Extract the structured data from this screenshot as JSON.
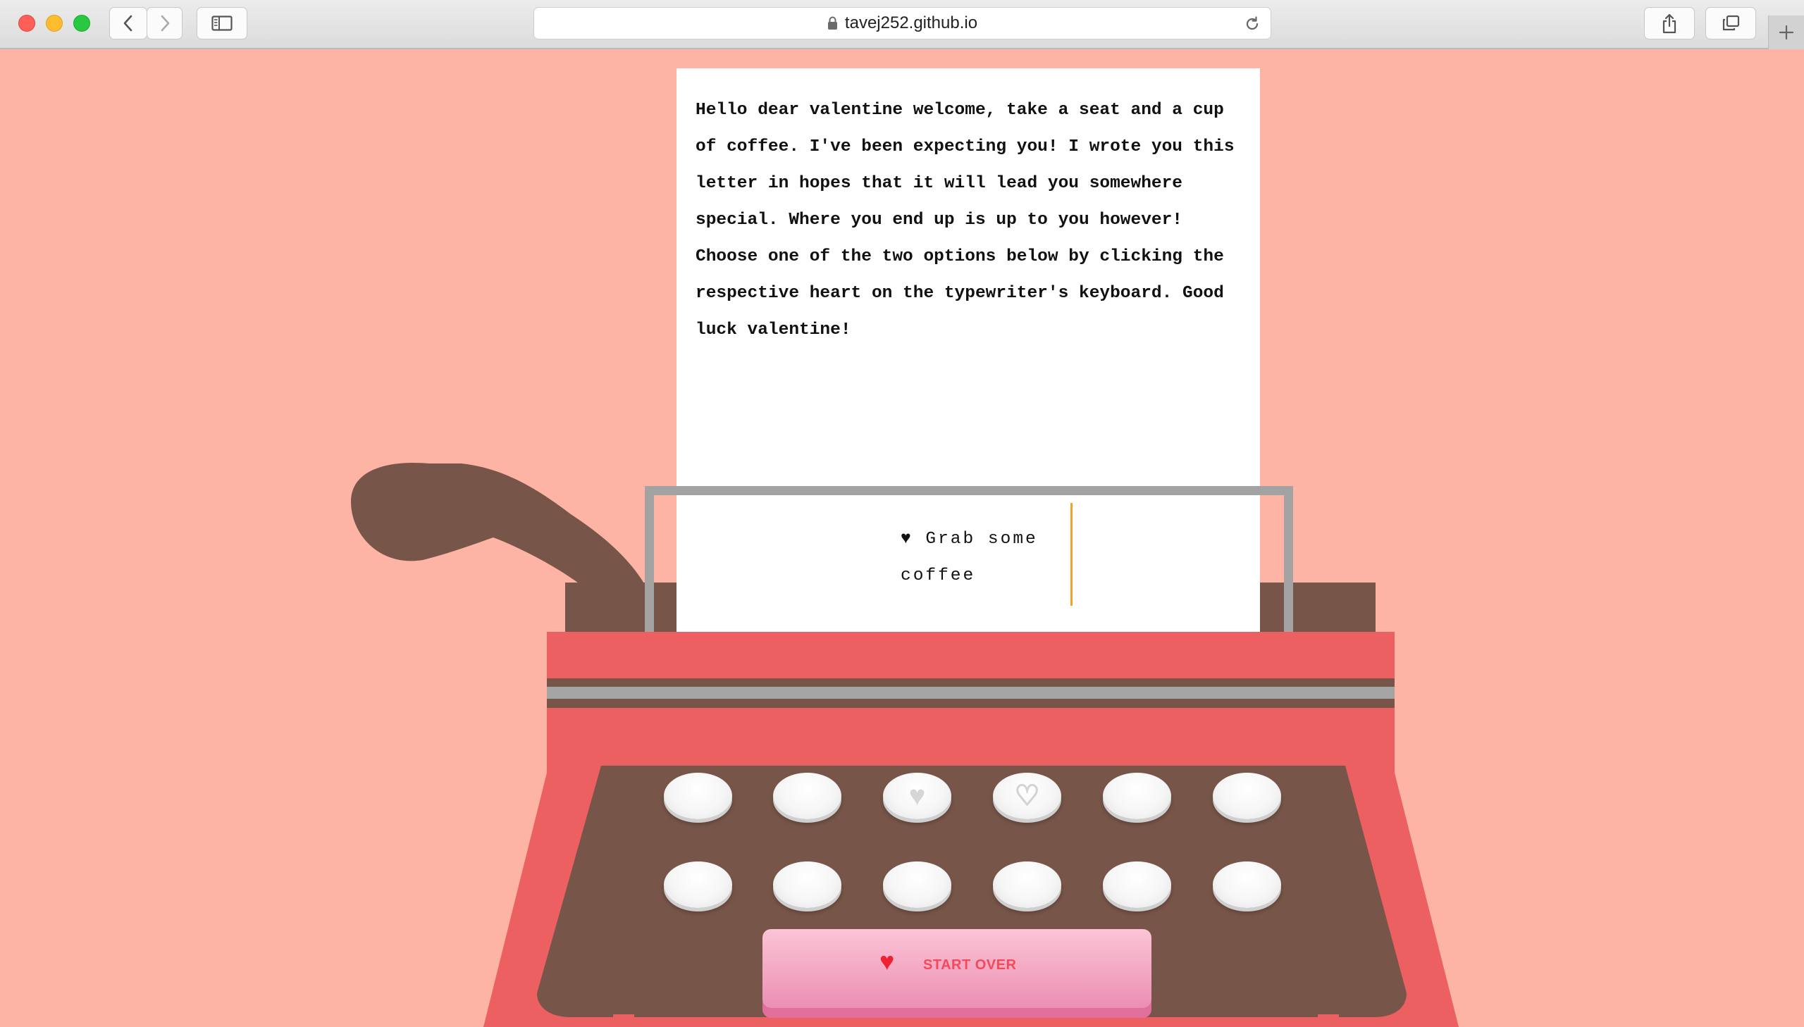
{
  "browser": {
    "url": "tavej252.github.io",
    "icons": [
      "close-icon",
      "minimize-icon",
      "zoom-icon",
      "back-icon",
      "forward-icon",
      "sidebar-icon",
      "lock-icon",
      "reload-icon",
      "share-icon",
      "tabs-icon",
      "new-tab-icon"
    ]
  },
  "letter": {
    "text": "Hello dear valentine welcome, take a seat and a cup of coffee. I've been expecting you! I wrote you this letter in hopes that it will lead you somewhere special. Where you end up is up to you however! Choose one of the two options below by clicking the respective heart on the typewriter's keyboard. Good luck valentine!"
  },
  "typing": {
    "current": "♥ Grab some coffee"
  },
  "keyboard": {
    "option_one": "♥",
    "option_two": "♡"
  },
  "start_over": {
    "icon": "♥",
    "label": "START OVER"
  },
  "colors": {
    "background": "#fdb4a5",
    "typewriter_red": "#ec6061",
    "typewriter_brown": "#775548",
    "caret": "#f4a12a",
    "button_pink": "#eb8fb3"
  }
}
